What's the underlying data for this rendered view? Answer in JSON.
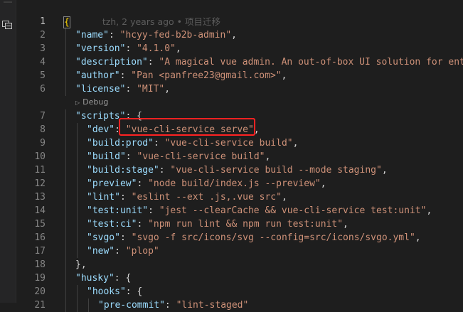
{
  "activity": {
    "icon": "split-editor-icon"
  },
  "blame": "tzh, 2 years ago • 项目迁移",
  "codelens": {
    "label": "Debug"
  },
  "lines": [
    {
      "n": "1",
      "parts": []
    },
    {
      "n": "2",
      "parts": [
        {
          "t": "\"name\"",
          "c": "k"
        },
        {
          "t": ": ",
          "c": "p"
        },
        {
          "t": "\"hcyy-fed-b2b-admin\"",
          "c": "s"
        },
        {
          "t": ",",
          "c": "p"
        }
      ]
    },
    {
      "n": "3",
      "parts": [
        {
          "t": "\"version\"",
          "c": "k"
        },
        {
          "t": ": ",
          "c": "p"
        },
        {
          "t": "\"4.1.0\"",
          "c": "s"
        },
        {
          "t": ",",
          "c": "p"
        }
      ]
    },
    {
      "n": "4",
      "parts": [
        {
          "t": "\"description\"",
          "c": "k"
        },
        {
          "t": ": ",
          "c": "p"
        },
        {
          "t": "\"A magical vue admin. An out-of-box UI solution for ente",
          "c": "s"
        }
      ]
    },
    {
      "n": "5",
      "parts": [
        {
          "t": "\"author\"",
          "c": "k"
        },
        {
          "t": ": ",
          "c": "p"
        },
        {
          "t": "\"Pan <panfree23@gmail.com>\"",
          "c": "s"
        },
        {
          "t": ",",
          "c": "p"
        }
      ]
    },
    {
      "n": "6",
      "parts": [
        {
          "t": "\"license\"",
          "c": "k"
        },
        {
          "t": ": ",
          "c": "p"
        },
        {
          "t": "\"MIT\"",
          "c": "s"
        },
        {
          "t": ",",
          "c": "p"
        }
      ]
    },
    {
      "n": "7",
      "parts": [
        {
          "t": "\"scripts\"",
          "c": "k"
        },
        {
          "t": ": {",
          "c": "p"
        }
      ]
    },
    {
      "n": "8",
      "parts": [
        {
          "t": "\"dev\"",
          "c": "k"
        },
        {
          "t": ": ",
          "c": "p"
        },
        {
          "t": "\"vue-cli-service serve\"",
          "c": "s"
        },
        {
          "t": ",",
          "c": "p"
        }
      ]
    },
    {
      "n": "9",
      "parts": [
        {
          "t": "\"build:prod\"",
          "c": "k"
        },
        {
          "t": ": ",
          "c": "p"
        },
        {
          "t": "\"vue-cli-service build\"",
          "c": "s"
        },
        {
          "t": ",",
          "c": "p"
        }
      ]
    },
    {
      "n": "10",
      "parts": [
        {
          "t": "\"build\"",
          "c": "k"
        },
        {
          "t": ": ",
          "c": "p"
        },
        {
          "t": "\"vue-cli-service build\"",
          "c": "s"
        },
        {
          "t": ",",
          "c": "p"
        }
      ]
    },
    {
      "n": "11",
      "parts": [
        {
          "t": "\"build:stage\"",
          "c": "k"
        },
        {
          "t": ": ",
          "c": "p"
        },
        {
          "t": "\"vue-cli-service build --mode staging\"",
          "c": "s"
        },
        {
          "t": ",",
          "c": "p"
        }
      ]
    },
    {
      "n": "12",
      "parts": [
        {
          "t": "\"preview\"",
          "c": "k"
        },
        {
          "t": ": ",
          "c": "p"
        },
        {
          "t": "\"node build/index.js --preview\"",
          "c": "s"
        },
        {
          "t": ",",
          "c": "p"
        }
      ]
    },
    {
      "n": "13",
      "parts": [
        {
          "t": "\"lint\"",
          "c": "k"
        },
        {
          "t": ": ",
          "c": "p"
        },
        {
          "t": "\"eslint --ext .js,.vue src\"",
          "c": "s"
        },
        {
          "t": ",",
          "c": "p"
        }
      ]
    },
    {
      "n": "14",
      "parts": [
        {
          "t": "\"test:unit\"",
          "c": "k"
        },
        {
          "t": ": ",
          "c": "p"
        },
        {
          "t": "\"jest --clearCache && vue-cli-service test:unit\"",
          "c": "s"
        },
        {
          "t": ",",
          "c": "p"
        }
      ]
    },
    {
      "n": "15",
      "parts": [
        {
          "t": "\"test:ci\"",
          "c": "k"
        },
        {
          "t": ": ",
          "c": "p"
        },
        {
          "t": "\"npm run lint && npm run test:unit\"",
          "c": "s"
        },
        {
          "t": ",",
          "c": "p"
        }
      ]
    },
    {
      "n": "16",
      "parts": [
        {
          "t": "\"svgo\"",
          "c": "k"
        },
        {
          "t": ": ",
          "c": "p"
        },
        {
          "t": "\"svgo -f src/icons/svg --config=src/icons/svgo.yml\"",
          "c": "s"
        },
        {
          "t": ",",
          "c": "p"
        }
      ]
    },
    {
      "n": "17",
      "parts": [
        {
          "t": "\"new\"",
          "c": "k"
        },
        {
          "t": ": ",
          "c": "p"
        },
        {
          "t": "\"plop\"",
          "c": "s"
        }
      ]
    },
    {
      "n": "18",
      "parts": [
        {
          "t": "},",
          "c": "p"
        }
      ]
    },
    {
      "n": "19",
      "parts": [
        {
          "t": "\"husky\"",
          "c": "k"
        },
        {
          "t": ": {",
          "c": "p"
        }
      ]
    },
    {
      "n": "20",
      "parts": [
        {
          "t": "\"hooks\"",
          "c": "k"
        },
        {
          "t": ": {",
          "c": "p"
        }
      ]
    },
    {
      "n": "21",
      "parts": [
        {
          "t": "\"pre-commit\"",
          "c": "k"
        },
        {
          "t": ": ",
          "c": "p"
        },
        {
          "t": "\"lint-staged\"",
          "c": "s"
        }
      ]
    }
  ],
  "colors": {
    "key": "#9cdcfe",
    "string": "#ce9178",
    "highlight": "#ff2222"
  }
}
